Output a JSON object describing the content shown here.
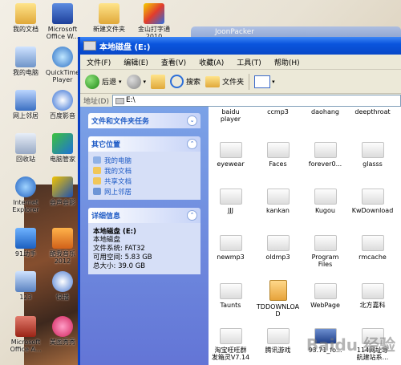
{
  "desktop": {
    "icons": [
      {
        "label": "我的文档"
      },
      {
        "label": "Microsoft\nOffice W..."
      },
      {
        "label": "新建文件夹"
      },
      {
        "label": "金山打字通\n2010"
      },
      {
        "label": "我的电脑"
      },
      {
        "label": "QuickTime\nPlayer"
      },
      {
        "label": "网上邻居"
      },
      {
        "label": "百度影音"
      },
      {
        "label": "回收站"
      },
      {
        "label": "电脑管家"
      },
      {
        "label": "Internet\nExplorer"
      },
      {
        "label": "会声会影"
      },
      {
        "label": "91助手"
      },
      {
        "label": "酷我音乐\n2012"
      },
      {
        "label": "123"
      },
      {
        "label": "快播"
      },
      {
        "label": "Microsoft\nOffice A..."
      },
      {
        "label": "美图秀秀"
      }
    ],
    "background_window_title": "JoonPacker"
  },
  "window": {
    "title": "本地磁盘 (E:)",
    "menu": [
      "文件(F)",
      "编辑(E)",
      "查看(V)",
      "收藏(A)",
      "工具(T)",
      "帮助(H)"
    ],
    "toolbar": {
      "back": "后退",
      "search": "搜索",
      "folders": "文件夹"
    },
    "address": {
      "label": "地址(D)",
      "value": "E:\\"
    }
  },
  "left_pane": {
    "tasks_title": "文件和文件夹任务",
    "other_places_title": "其它位置",
    "other_places": [
      "我的电脑",
      "我的文档",
      "共享文档",
      "网上邻居"
    ],
    "details_title": "详细信息",
    "details": {
      "name": "本地磁盘 (E:)",
      "type": "本地磁盘",
      "filesystem": "文件系统: FAT32",
      "free": "可用空间: 5.83 GB",
      "total": "总大小: 39.0 GB"
    }
  },
  "files": {
    "top_row": [
      "baidu\nplayer",
      "ccmp3",
      "daohang",
      "deepthroat"
    ],
    "rows": [
      [
        "eyewear",
        "Faces",
        "forever0...",
        "glasss"
      ],
      [
        "JJJ",
        "kankan",
        "Kugou",
        "KwDownload"
      ],
      [
        "newmp3",
        "oldmp3",
        "Program\nFiles",
        "rmcache"
      ],
      [
        "Taunts",
        "TDDOWNLOAD",
        "WebPage",
        "北方嘉科"
      ],
      [
        "淘宝旺旺群\n发箱灵V7.14",
        "腾讯游戏",
        "93.71_fo...",
        "114网址导\n航建站系..."
      ]
    ]
  },
  "watermark": "Baidu 经验"
}
